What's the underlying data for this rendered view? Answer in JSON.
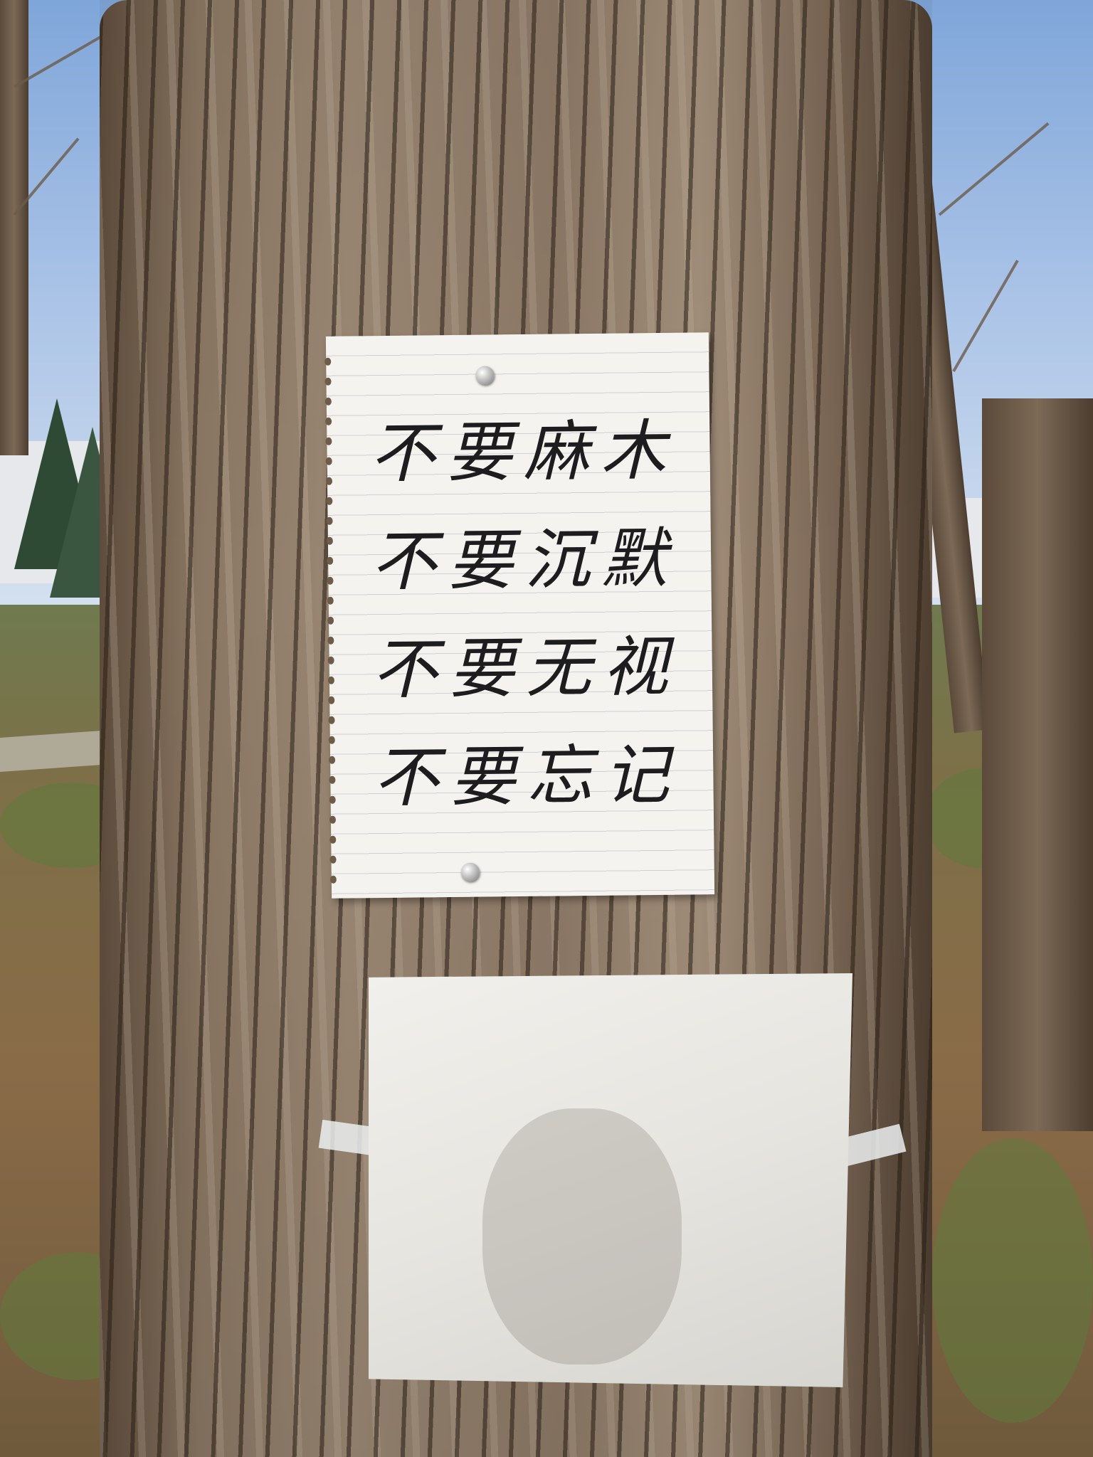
{
  "note": {
    "lines": [
      "不要麻木",
      "不要沉默",
      "不要无视",
      "不要忘记"
    ]
  },
  "colors": {
    "sky": "#9dbbe3",
    "bark": "#8a7763",
    "paper": "#f4f3ef",
    "ink": "#1d1d1f"
  }
}
